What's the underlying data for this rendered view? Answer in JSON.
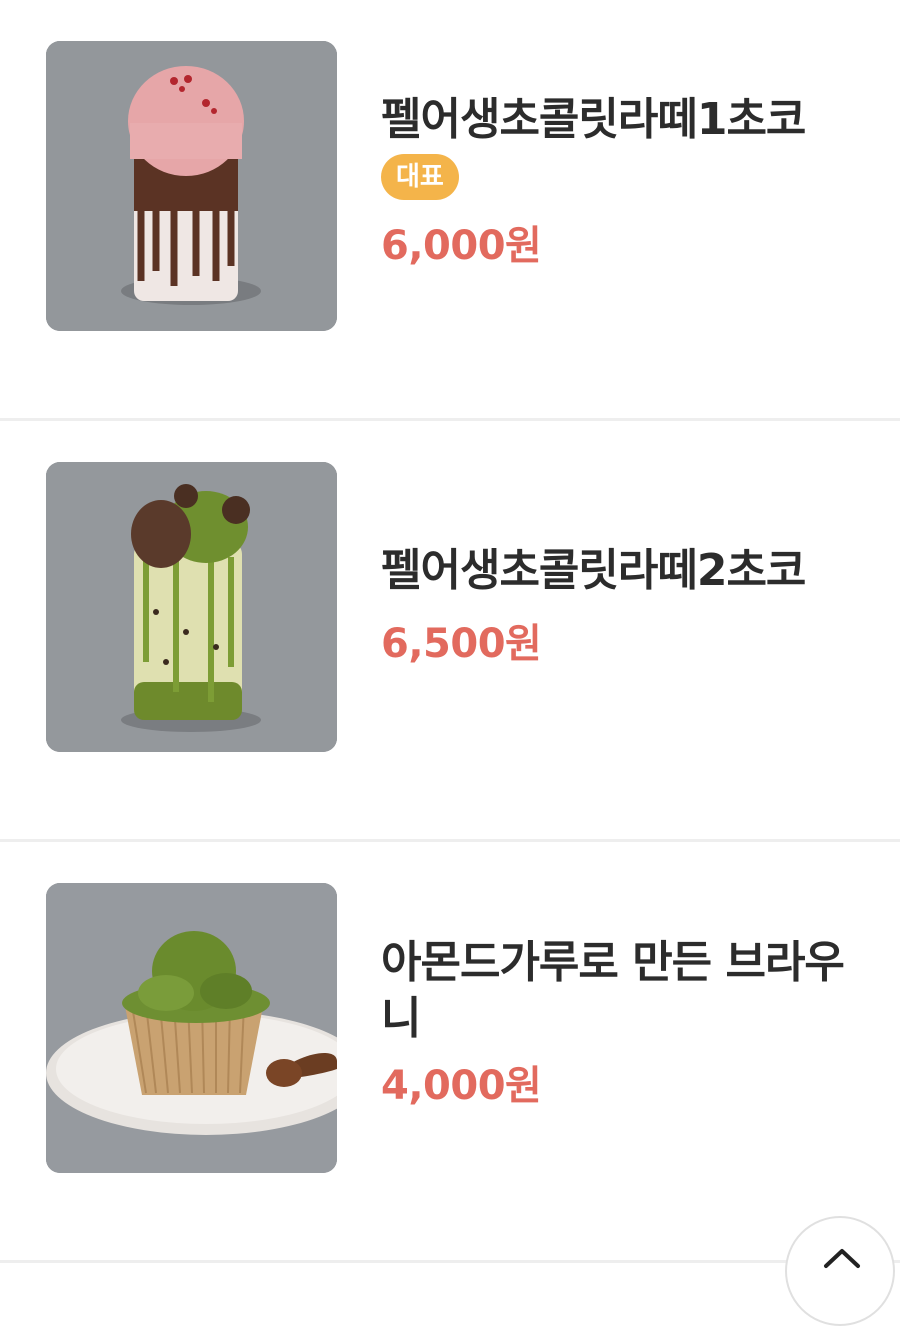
{
  "menu": {
    "items": [
      {
        "name": "펠어생초콜릿라떼1초코",
        "badge": "대표",
        "price": "6,000원",
        "image_icon": "pink-cream-chocolate-latte-photo"
      },
      {
        "name": "펠어생초콜릿라떼2초코",
        "price": "6,500원",
        "image_icon": "matcha-chocolate-latte-photo"
      },
      {
        "name": "아몬드가루로 만든 브라우니",
        "price": "4,000원",
        "image_icon": "matcha-brownie-photo"
      }
    ]
  },
  "scroll_top": {
    "icon": "chevron-up-icon"
  },
  "colors": {
    "price": "#e26a5e",
    "badge": "#f4b44a",
    "divider": "#eeeeee"
  }
}
